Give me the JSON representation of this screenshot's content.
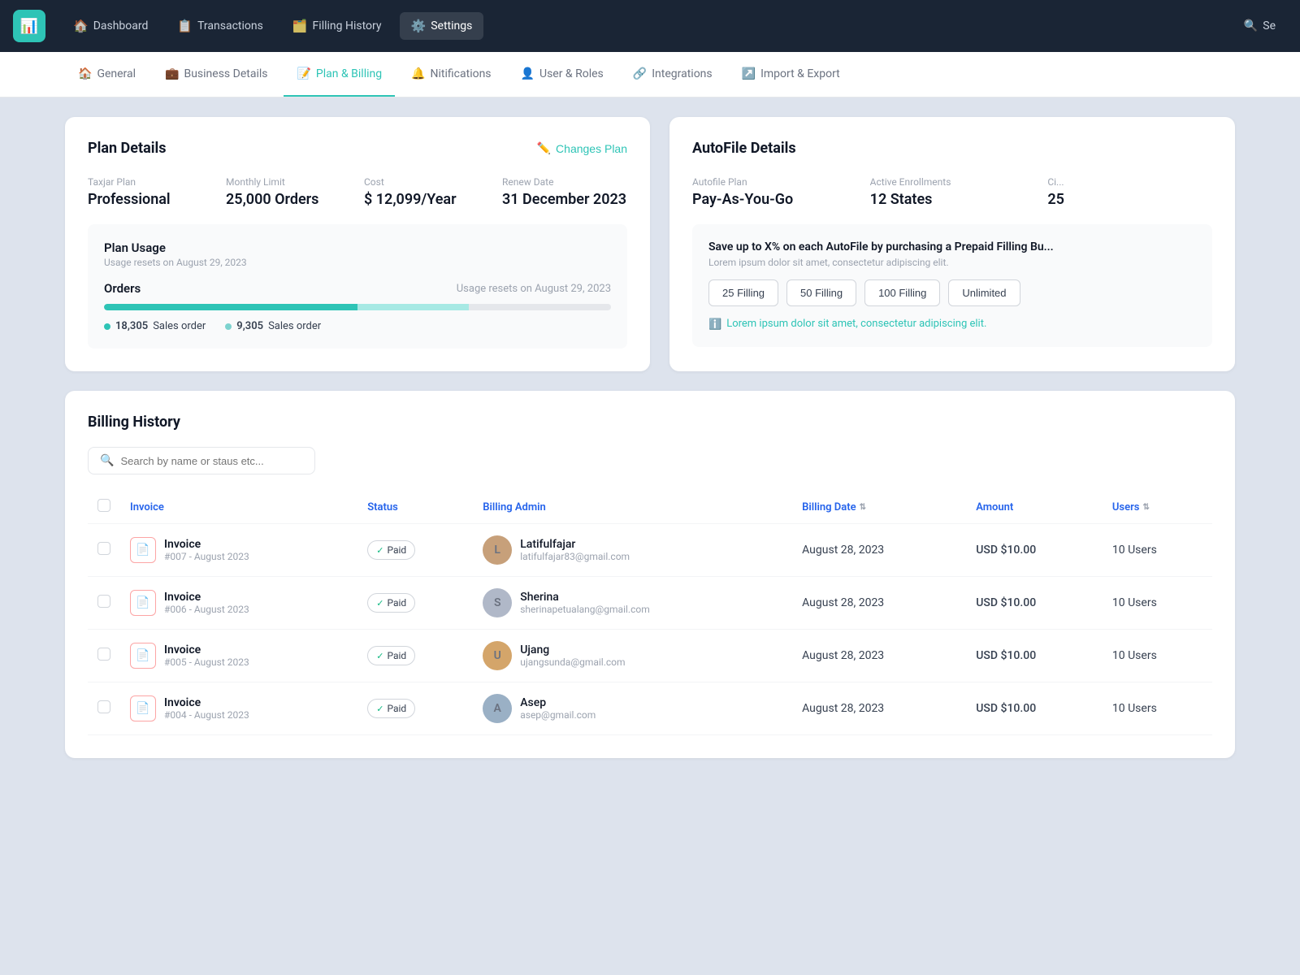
{
  "topNav": {
    "logo": "📊",
    "items": [
      {
        "id": "dashboard",
        "label": "Dashboard",
        "icon": "🏠",
        "active": false
      },
      {
        "id": "transactions",
        "label": "Transactions",
        "icon": "📋",
        "active": false
      },
      {
        "id": "filling-history",
        "label": "Filling History",
        "icon": "🗂️",
        "active": false
      },
      {
        "id": "settings",
        "label": "Settings",
        "icon": "⚙️",
        "active": true
      }
    ],
    "searchLabel": "Se"
  },
  "subNav": {
    "items": [
      {
        "id": "general",
        "label": "General",
        "icon": "🏠",
        "active": false
      },
      {
        "id": "business-details",
        "label": "Business Details",
        "icon": "💼",
        "active": false
      },
      {
        "id": "plan-billing",
        "label": "Plan & Billing",
        "icon": "📝",
        "active": true
      },
      {
        "id": "notifications",
        "label": "Nitifications",
        "icon": "🔔",
        "active": false
      },
      {
        "id": "user-roles",
        "label": "User & Roles",
        "icon": "👤",
        "active": false
      },
      {
        "id": "integrations",
        "label": "Integrations",
        "icon": "🔗",
        "active": false
      },
      {
        "id": "import-export",
        "label": "Import & Export",
        "icon": "↗️",
        "active": false
      }
    ]
  },
  "planDetails": {
    "title": "Plan Details",
    "changesPlanLabel": "Changes Plan",
    "fields": {
      "taxjarPlanLabel": "Taxjar Plan",
      "taxjarPlanValue": "Professional",
      "monthlyLimitLabel": "Monthly Limit",
      "monthlyLimitValue": "25,000 Orders",
      "costLabel": "Cost",
      "costValue": "$ 12,099/Year",
      "renewDateLabel": "Renew Date",
      "renewDateValue": "31 December 2023"
    },
    "planUsage": {
      "title": "Plan Usage",
      "subtitle": "Usage resets on August 29, 2023",
      "ordersLabel": "Orders",
      "resetText": "Usage resets on August 29, 2023",
      "progressGreenPct": 50,
      "progressLightPct": 22,
      "stat1Number": "18,305",
      "stat1Label": "Sales order",
      "stat2Number": "9,305",
      "stat2Label": "Sales order"
    }
  },
  "autofileDetails": {
    "title": "AutoFile Details",
    "fields": {
      "autofilePlanLabel": "Autofile Plan",
      "autofilePlanValue": "Pay-As-You-Go",
      "activeEnrollmentsLabel": "Active Enrollments",
      "activeEnrollmentsValue": "12 States",
      "thirdLabel": "Ci...",
      "thirdValue": "25"
    },
    "promo": {
      "title": "Save up to X% on each AutoFile by purchasing a Prepaid Filling Bu...",
      "subtitle": "Lorem ipsum dolor sit amet, consectetur adipiscing elit.",
      "buttons": [
        {
          "id": "25-filling",
          "label": "25 Filling"
        },
        {
          "id": "50-filling",
          "label": "50 Filling"
        },
        {
          "id": "100-filling",
          "label": "100 Filling"
        },
        {
          "id": "unlimited",
          "label": "Unlimited"
        }
      ],
      "noteText": "Lorem ipsum dolor sit amet, consectetur adipiscing elit."
    }
  },
  "billingHistory": {
    "title": "Billing History",
    "search": {
      "placeholder": "Search by name or staus etc..."
    },
    "table": {
      "columns": [
        {
          "id": "invoice",
          "label": "Invoice",
          "sortable": false
        },
        {
          "id": "status",
          "label": "Status",
          "sortable": false
        },
        {
          "id": "billing-admin",
          "label": "Billing Admin",
          "sortable": false
        },
        {
          "id": "billing-date",
          "label": "Billing Date",
          "sortable": true
        },
        {
          "id": "amount",
          "label": "Amount",
          "sortable": false
        },
        {
          "id": "users",
          "label": "Users",
          "sortable": true
        }
      ],
      "rows": [
        {
          "id": "inv-007",
          "invoiceName": "Invoice",
          "invoiceNum": "#007 - August 2023",
          "status": "Paid",
          "adminName": "Latifulfajar",
          "adminEmail": "latifulfajar83@gmail.com",
          "avatarInitial": "L",
          "avatarClass": "avatar-1",
          "billingDate": "August 28, 2023",
          "amount": "USD $10.00",
          "users": "10 Users"
        },
        {
          "id": "inv-006",
          "invoiceName": "Invoice",
          "invoiceNum": "#006 - August 2023",
          "status": "Paid",
          "adminName": "Sherina",
          "adminEmail": "sherinapetualang@gmail.com",
          "avatarInitial": "S",
          "avatarClass": "avatar-2",
          "billingDate": "August 28, 2023",
          "amount": "USD $10.00",
          "users": "10 Users"
        },
        {
          "id": "inv-005",
          "invoiceName": "Invoice",
          "invoiceNum": "#005 - August 2023",
          "status": "Paid",
          "adminName": "Ujang",
          "adminEmail": "ujangsunda@gmail.com",
          "avatarInitial": "U",
          "avatarClass": "avatar-3",
          "billingDate": "August 28, 2023",
          "amount": "USD $10.00",
          "users": "10 Users"
        },
        {
          "id": "inv-004",
          "invoiceName": "Invoice",
          "invoiceNum": "#004 - August 2023",
          "status": "Paid",
          "adminName": "Asep",
          "adminEmail": "asep@gmail.com",
          "avatarInitial": "A",
          "avatarClass": "avatar-4",
          "billingDate": "August 28, 2023",
          "amount": "USD $10.00",
          "users": "10 Users"
        }
      ]
    }
  }
}
